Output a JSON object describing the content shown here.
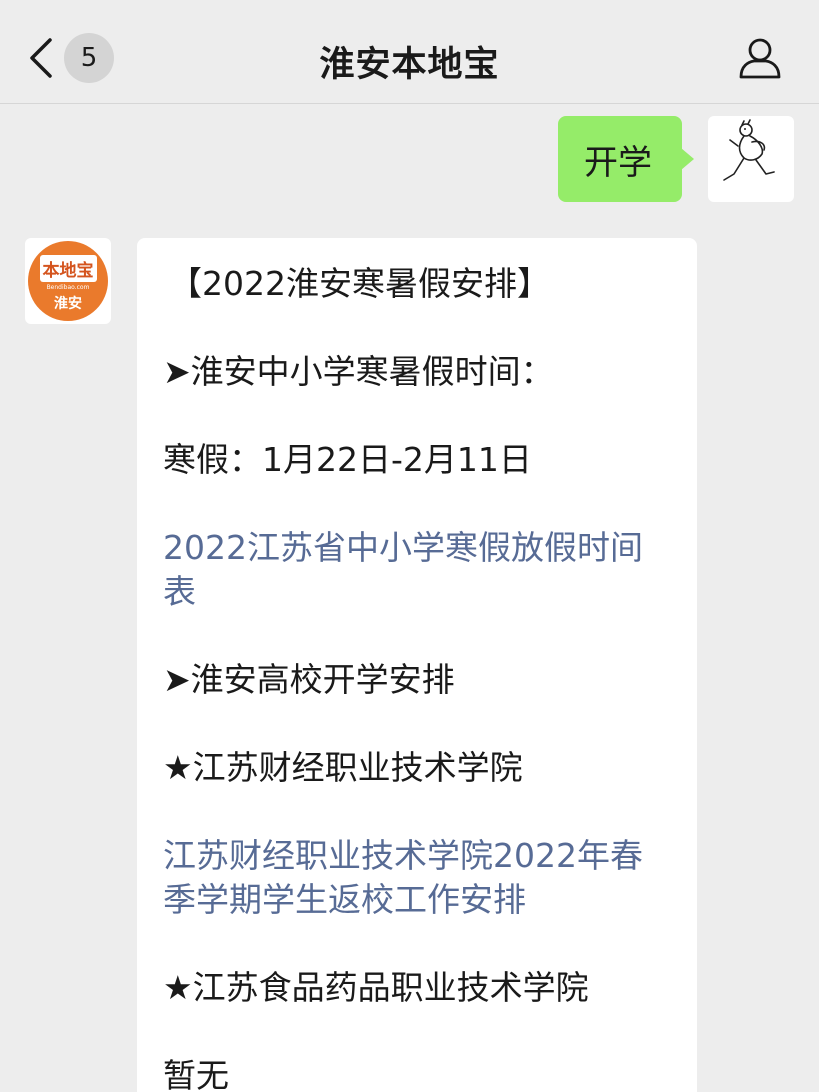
{
  "navbar": {
    "back_icon": "chevron-left-icon",
    "unread_count": "5",
    "title": "淮安本地宝",
    "profile_icon": "person-icon"
  },
  "outgoing": {
    "text": "开学"
  },
  "account_avatar": {
    "logo_text": "本地宝",
    "logo_url": "Bendibao.com",
    "logo_city": "淮安"
  },
  "incoming": {
    "lines": [
      "【2022淮安寒暑假安排】",
      "➤淮安中小学寒暑假时间：",
      "寒假：1月22日-2月11日",
      "2022江苏省中小学寒假放假时间表",
      "➤淮安高校开学安排",
      "★江苏财经职业技术学院",
      "江苏财经职业技术学院2022年春季学期学生返校工作安排",
      "★江苏食品药品职业技术学院",
      "暂无"
    ]
  },
  "colors": {
    "background": "#ededed",
    "bubble_out": "#95ec69",
    "link": "#576b95",
    "logo_orange": "#ea7a2c"
  }
}
